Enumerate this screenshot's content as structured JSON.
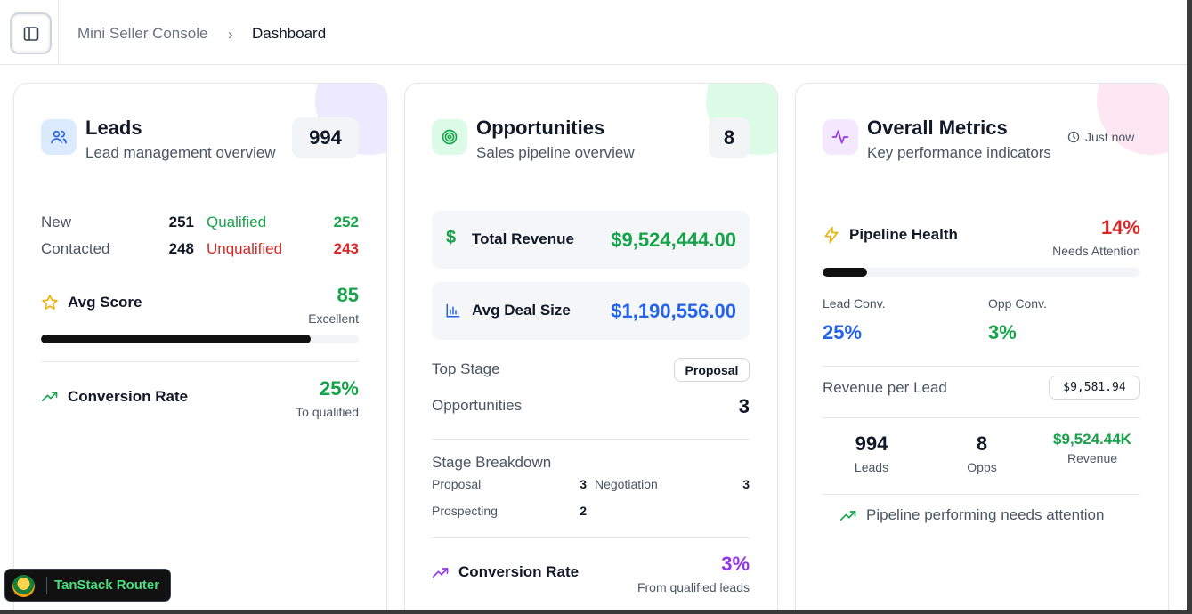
{
  "breadcrumb": {
    "app": "Mini Seller Console",
    "separator": "›",
    "current": "Dashboard"
  },
  "leads": {
    "title": "Leads",
    "subtitle": "Lead management overview",
    "count": "994",
    "rows": [
      {
        "label": "New",
        "value": "251",
        "status_label": "Qualified",
        "status_value": "252"
      },
      {
        "label": "Contacted",
        "value": "248",
        "status_label": "Unqualified",
        "status_value": "243"
      }
    ],
    "avg_score": {
      "label": "Avg Score",
      "value": "85",
      "caption": "Excellent",
      "progress": 0.85
    },
    "conversion": {
      "label": "Conversion Rate",
      "value": "25%",
      "caption": "To qualified"
    }
  },
  "opportunities": {
    "title": "Opportunities",
    "subtitle": "Sales pipeline overview",
    "count": "8",
    "total_revenue": {
      "label": "Total Revenue",
      "value": "$9,524,444.00"
    },
    "avg_deal": {
      "label": "Avg Deal Size",
      "value": "$1,190,556.00"
    },
    "top_stage": {
      "label": "Top Stage",
      "value": "Proposal"
    },
    "opportunities_row": {
      "label": "Opportunities",
      "value": "3"
    },
    "stage_breakdown": {
      "title": "Stage Breakdown",
      "items": [
        {
          "name": "Proposal",
          "count": "3"
        },
        {
          "name": "Negotiation",
          "count": "3"
        },
        {
          "name": "Prospecting",
          "count": "2"
        }
      ]
    },
    "conversion": {
      "label": "Conversion Rate",
      "value": "3%",
      "caption": "From qualified leads"
    }
  },
  "metrics": {
    "title": "Overall Metrics",
    "subtitle": "Key performance indicators",
    "updated": "Just now",
    "pipeline_health": {
      "label": "Pipeline Health",
      "value": "14%",
      "caption": "Needs Attention",
      "progress": 0.14
    },
    "lead_conv": {
      "label": "Lead Conv.",
      "value": "25%"
    },
    "opp_conv": {
      "label": "Opp Conv.",
      "value": "3%"
    },
    "revenue_per_lead": {
      "label": "Revenue per Lead",
      "value": "$9,581.94"
    },
    "summary": [
      {
        "value": "994",
        "label": "Leads"
      },
      {
        "value": "8",
        "label": "Opps"
      },
      {
        "value": "$9,524.44K",
        "label": "Revenue"
      }
    ],
    "status_message": "Pipeline performing needs attention"
  },
  "devtools": {
    "label": "TanStack Router"
  },
  "colors": {
    "green": "#16a34a",
    "red": "#dc2626",
    "blue": "#2563eb",
    "purple": "#9333ea",
    "amber": "#eab308"
  }
}
